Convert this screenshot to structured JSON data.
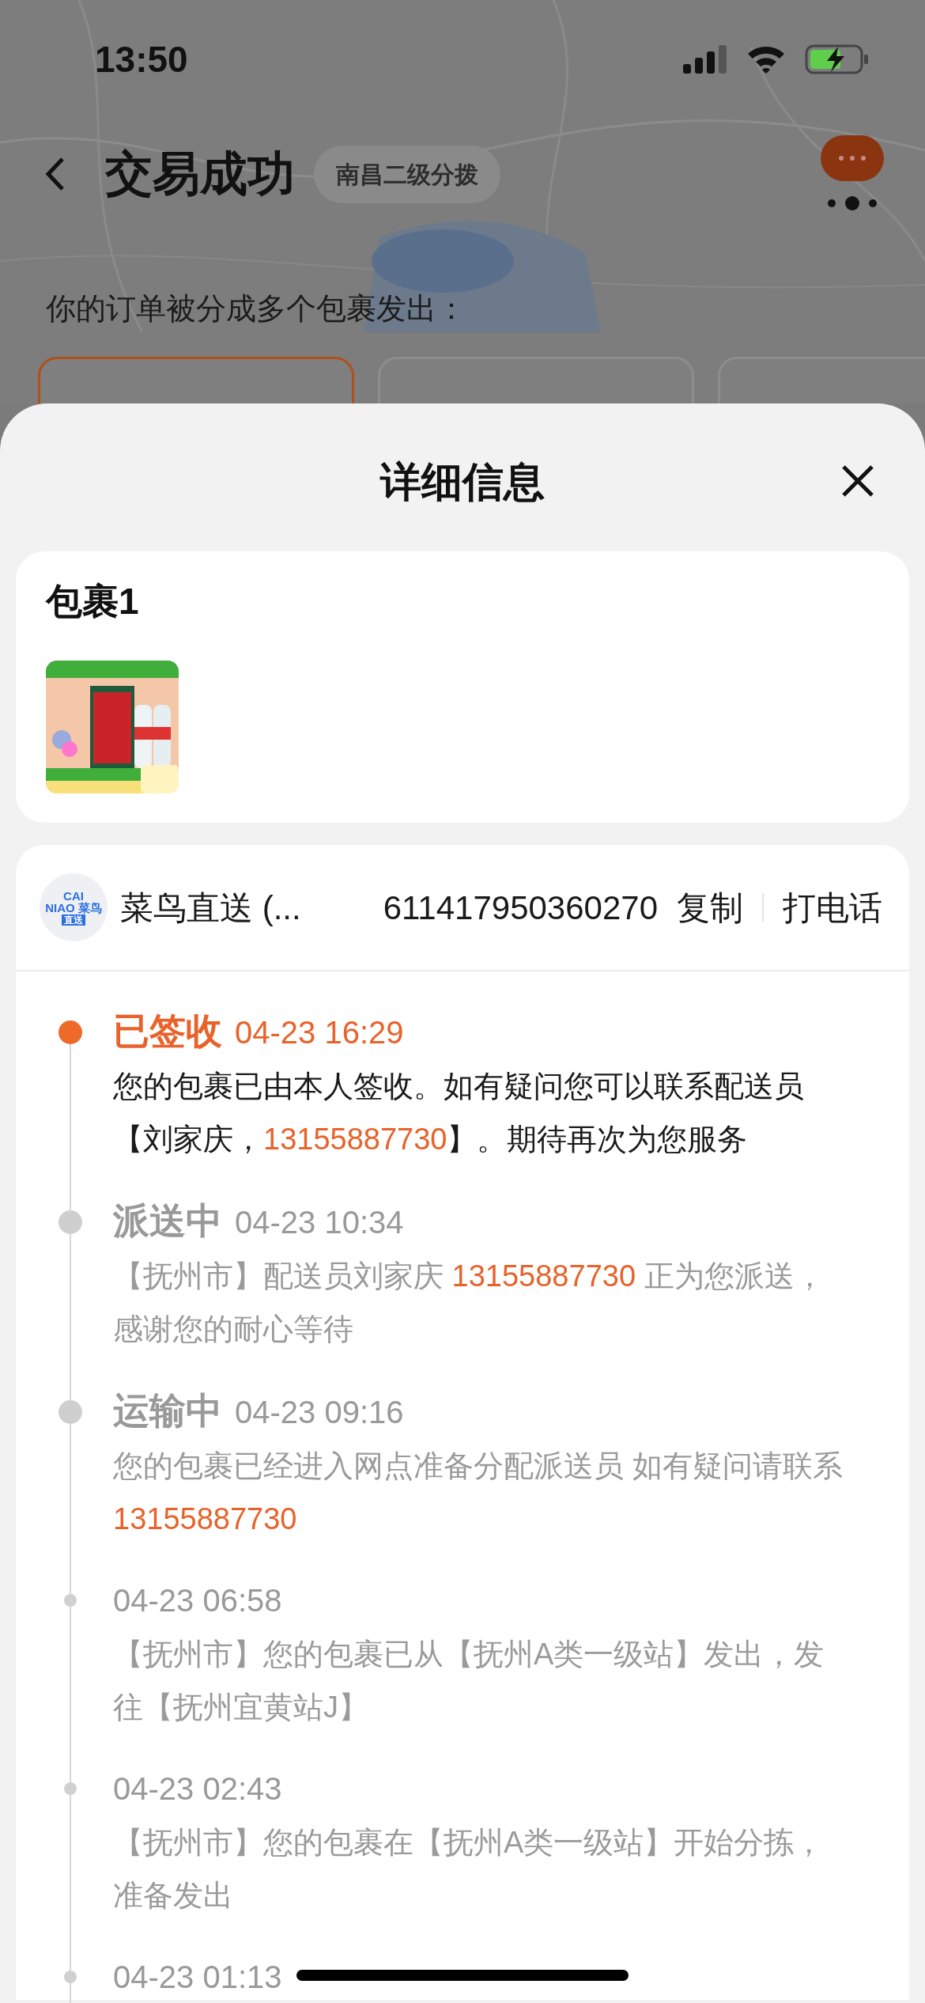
{
  "status_bar": {
    "time": "13:50"
  },
  "nav": {
    "title": "交易成功",
    "map_chip": "南昌二级分拨"
  },
  "split_notice": "你的订单被分成多个包裹发出：",
  "package_tabs": [
    {
      "selected": true
    },
    {
      "selected": false
    },
    {
      "selected": false
    }
  ],
  "sheet": {
    "title": "详细信息"
  },
  "package": {
    "title": "包裹1"
  },
  "tracking": {
    "logo_lines": [
      "CAI",
      "NIAO 菜鸟",
      "直送"
    ],
    "carrier": "菜鸟直送 (...",
    "number": "611417950360270",
    "copy": "复制",
    "call": "打电话",
    "events": [
      {
        "kind": "major",
        "active": true,
        "status": "已签收",
        "time": "04-23 16:29",
        "description": [
          {
            "text": "您的包裹已由本人签收。如有疑问您可以联系配送员【刘家庆，",
            "phone": false
          },
          {
            "text": "13155887730",
            "phone": true
          },
          {
            "text": "】。期待再次为您服务",
            "phone": false
          }
        ]
      },
      {
        "kind": "major",
        "active": false,
        "status": "派送中",
        "time": "04-23 10:34",
        "description": [
          {
            "text": "【抚州市】配送员刘家庆 ",
            "phone": false
          },
          {
            "text": "13155887730",
            "phone": true
          },
          {
            "text": " 正为您派送，感谢您的耐心等待",
            "phone": false
          }
        ]
      },
      {
        "kind": "major",
        "active": false,
        "status": "运输中",
        "time": "04-23 09:16",
        "description": [
          {
            "text": "您的包裹已经进入网点准备分配派送员 如有疑问请联系 ",
            "phone": false
          },
          {
            "text": "13155887730",
            "phone": true
          }
        ]
      },
      {
        "kind": "minor",
        "active": false,
        "time": "04-23 06:58",
        "description": [
          {
            "text": "【抚州市】您的包裹已从【抚州A类一级站】发出，发往【抚州宜黄站J】",
            "phone": false
          }
        ]
      },
      {
        "kind": "minor",
        "active": false,
        "time": "04-23 02:43",
        "description": [
          {
            "text": "【抚州市】您的包裹在【抚州A类一级站】开始分拣，准备发出",
            "phone": false
          }
        ]
      },
      {
        "kind": "minor",
        "active": false,
        "time": "04-23 01:13"
      }
    ]
  }
}
